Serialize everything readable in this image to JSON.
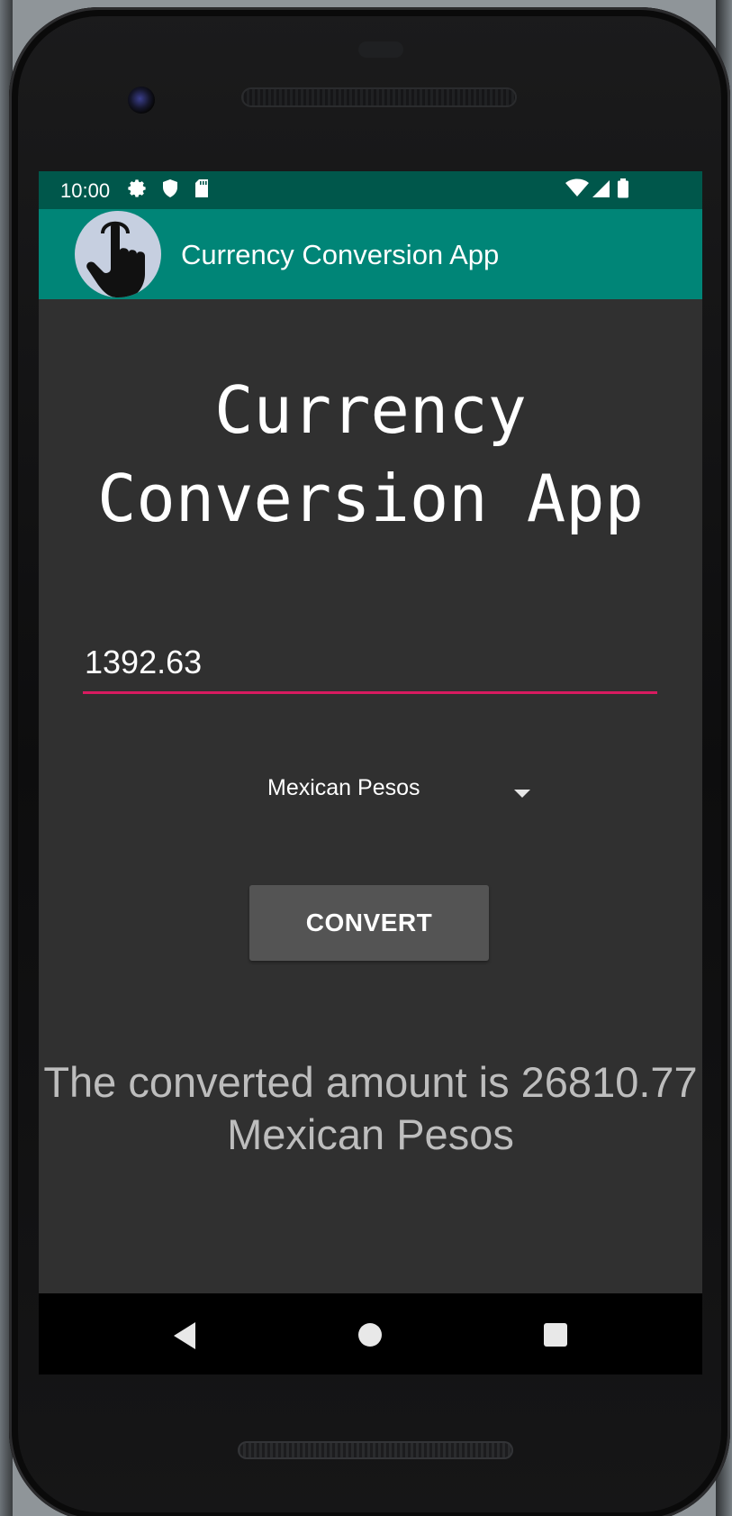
{
  "status_bar": {
    "time": "10:00",
    "icons": [
      "settings-icon",
      "shield-icon",
      "sd-card-icon",
      "wifi-icon",
      "signal-icon",
      "battery-icon"
    ]
  },
  "app_bar": {
    "title": "Currency Conversion App",
    "logo_icon": "hand-pointer-icon"
  },
  "main": {
    "heading": "Currency Conversion App",
    "amount_input": {
      "value": "1392.63"
    },
    "currency_select": {
      "selected": "Mexican Pesos"
    },
    "convert_button": {
      "label": "CONVERT"
    },
    "result_text": "The converted amount is 26810.77 Mexican Pesos"
  },
  "navigation_bar": {
    "icons": [
      "back-icon",
      "home-icon",
      "recents-icon"
    ]
  },
  "colors": {
    "status_bar": "#00574b",
    "app_bar": "#008577",
    "accent": "#d81b60",
    "background": "#303030",
    "button": "#545454",
    "result_text": "#bdbdbd"
  }
}
